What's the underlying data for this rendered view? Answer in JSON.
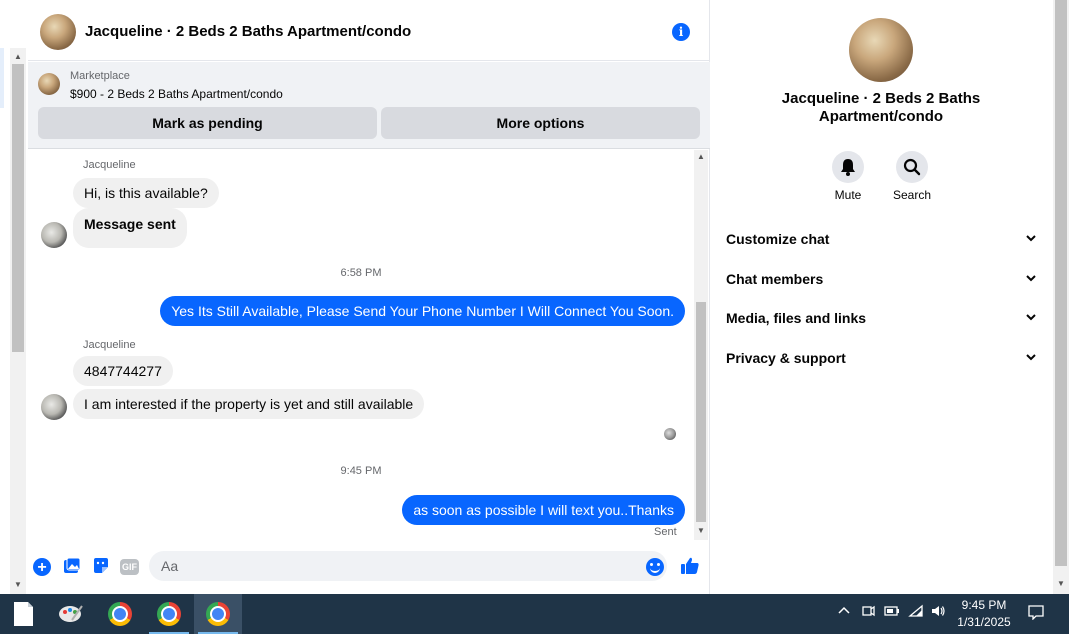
{
  "chat_header": {
    "title": "Jacqueline · 2 Beds 2 Baths Apartment/condo"
  },
  "marketplace": {
    "label": "Marketplace",
    "item": "$900 - 2 Beds 2 Baths Apartment/condo",
    "pending_label": "Mark as pending",
    "options_label": "More options"
  },
  "messages": {
    "sender1": "Jacqueline",
    "m1": "Hi, is this available?",
    "m2": "Message sent",
    "time1": "6:58 PM",
    "m3": "Yes Its Still Available, Please Send Your Phone Number I Will Connect You Soon.",
    "sender2": "Jacqueline",
    "m4": "4847744277",
    "m5": "I am interested if the property is yet and still available",
    "time2": "9:45 PM",
    "m6": "as soon as possible I will text you..Thanks",
    "status": "Sent"
  },
  "composer": {
    "placeholder": "Aa",
    "gif_label": "GIF"
  },
  "panel": {
    "title": "Jacqueline · 2 Beds 2 Baths Apartment/condo",
    "mute_label": "Mute",
    "search_label": "Search",
    "sections": [
      "Customize chat",
      "Chat members",
      "Media, files and links",
      "Privacy & support"
    ]
  },
  "taskbar": {
    "time": "9:45 PM",
    "date": "1/31/2025"
  },
  "colors": {
    "accent": "#0866ff",
    "taskbar": "#1f3447"
  },
  "icons": [
    "info-icon",
    "plus-icon",
    "photo-icon",
    "sticker-icon",
    "gif-icon",
    "emoji-icon",
    "like-icon",
    "bell-icon",
    "search-icon",
    "chevron-down-icon"
  ]
}
